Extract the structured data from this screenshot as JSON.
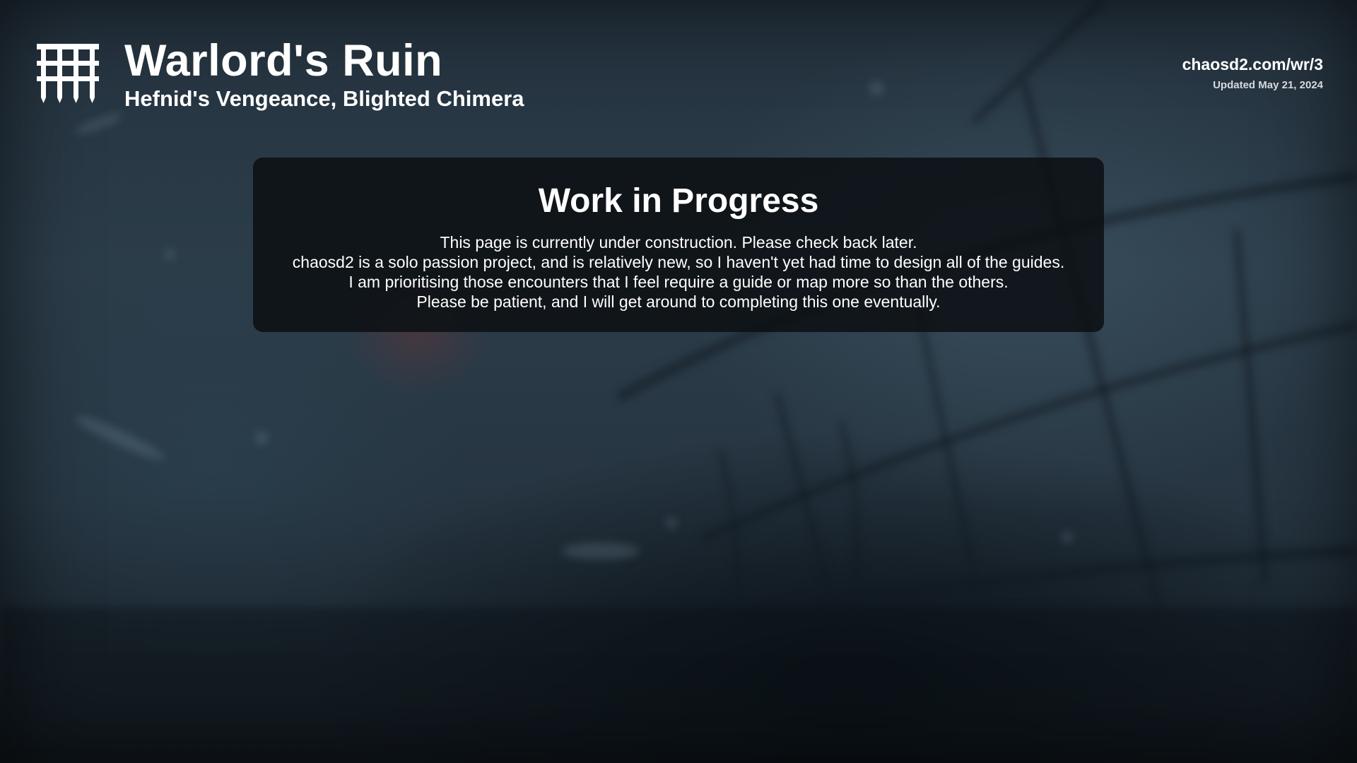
{
  "header": {
    "title": "Warlord's Ruin",
    "subtitle": "Hefnid's Vengeance, Blighted Chimera",
    "logo_icon": "portcullis-icon"
  },
  "meta": {
    "site_url": "chaosd2.com/wr/3",
    "updated": "Updated May 21, 2024"
  },
  "notice": {
    "title": "Work in Progress",
    "lines": [
      "This page is currently under construction. Please check back later.",
      "chaosd2 is a solo passion project, and is relatively new, so I haven't yet had time to design all of the guides.",
      "I am prioritising those encounters that I feel require a guide or map more so than the others.",
      "Please be patient, and I will get around to completing this one eventually."
    ]
  },
  "colors": {
    "text": "#ffffff",
    "card_background": "#0c0f13",
    "background": "#2c3d4a"
  }
}
